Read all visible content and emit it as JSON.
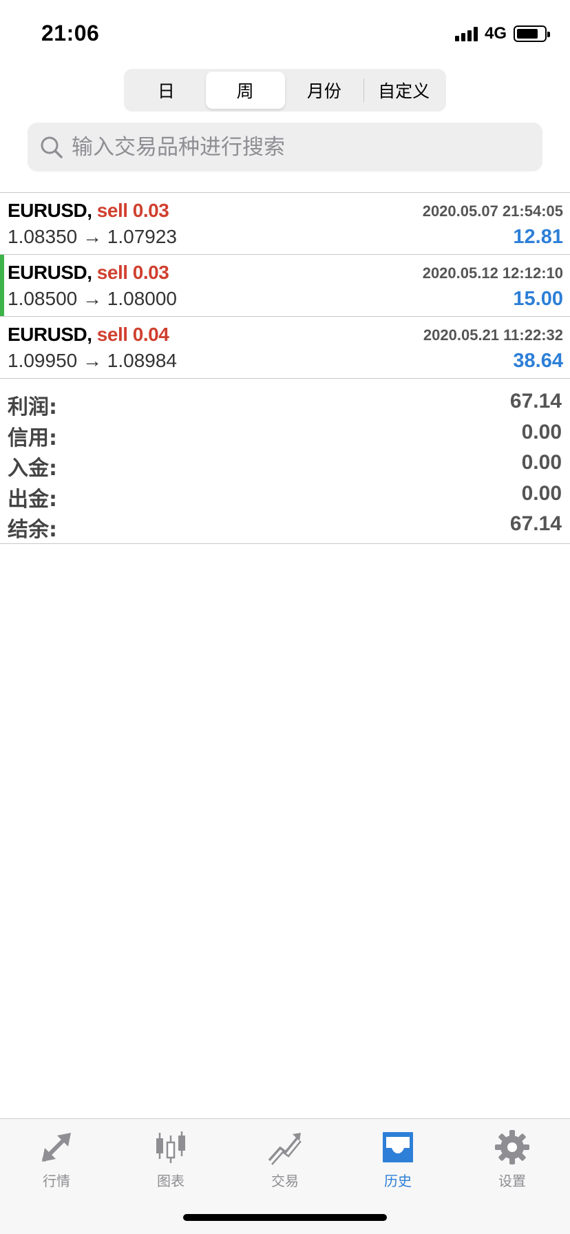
{
  "status_bar": {
    "time": "21:06",
    "network": "4G"
  },
  "period_tabs": [
    {
      "label": "日",
      "active": false
    },
    {
      "label": "周",
      "active": true
    },
    {
      "label": "月份",
      "active": false
    },
    {
      "label": "自定义",
      "active": false
    }
  ],
  "search": {
    "placeholder": "输入交易品种进行搜索"
  },
  "deals": [
    {
      "symbol": "EURUSD,",
      "side": "sell 0.03",
      "time": "2020.05.07 21:54:05",
      "prices": "1.08350 → 1.07923",
      "profit": "12.81"
    },
    {
      "symbol": "EURUSD,",
      "side": "sell 0.03",
      "time": "2020.05.12 12:12:10",
      "prices": "1.08500 → 1.08000",
      "profit": "15.00"
    },
    {
      "symbol": "EURUSD,",
      "side": "sell 0.04",
      "time": "2020.05.21 11:22:32",
      "prices": "1.09950 → 1.08984",
      "profit": "38.64"
    }
  ],
  "summary": [
    {
      "label": "利润:",
      "value": "67.14"
    },
    {
      "label": "信用:",
      "value": "0.00"
    },
    {
      "label": "入金:",
      "value": "0.00"
    },
    {
      "label": "出金:",
      "value": "0.00"
    },
    {
      "label": "结余:",
      "value": "67.14"
    }
  ],
  "tabbar": [
    {
      "label": "行情",
      "icon": "quotes-arrows-icon"
    },
    {
      "label": "图表",
      "icon": "candlestick-chart-icon"
    },
    {
      "label": "交易",
      "icon": "trade-chart-icon"
    },
    {
      "label": "历史",
      "icon": "inbox-history-icon",
      "active": true
    },
    {
      "label": "设置",
      "icon": "gear-icon"
    }
  ],
  "colors": {
    "accent": "#2d7fd7",
    "sell": "#d0402f",
    "highlight": "#3cb44a",
    "inactive": "#8e8e93"
  }
}
